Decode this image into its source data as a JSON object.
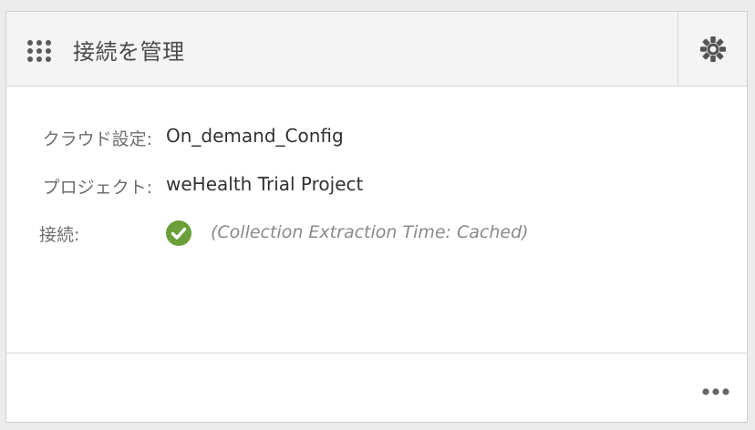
{
  "header": {
    "title": "接続を管理",
    "grip_icon": "grip-dots-icon",
    "settings_icon": "gear-icon"
  },
  "fields": {
    "cloud_label": "クラウド設定:",
    "cloud_value": "On_demand_Config",
    "project_label": "プロジェクト:",
    "project_value": "weHealth Trial Project",
    "connection_label": "接続:",
    "connection_status_icon": "check-circle-icon",
    "connection_status_color": "#6a9f3a",
    "connection_status_text": "(Collection Extraction Time: Cached)"
  },
  "footer": {
    "more_icon": "more-horizontal-icon"
  },
  "colors": {
    "header_bg": "#f4f4f4",
    "border": "#d6d6d6",
    "label_text": "#6e6e6e",
    "value_text": "#323232",
    "icon_gray": "#555555"
  }
}
